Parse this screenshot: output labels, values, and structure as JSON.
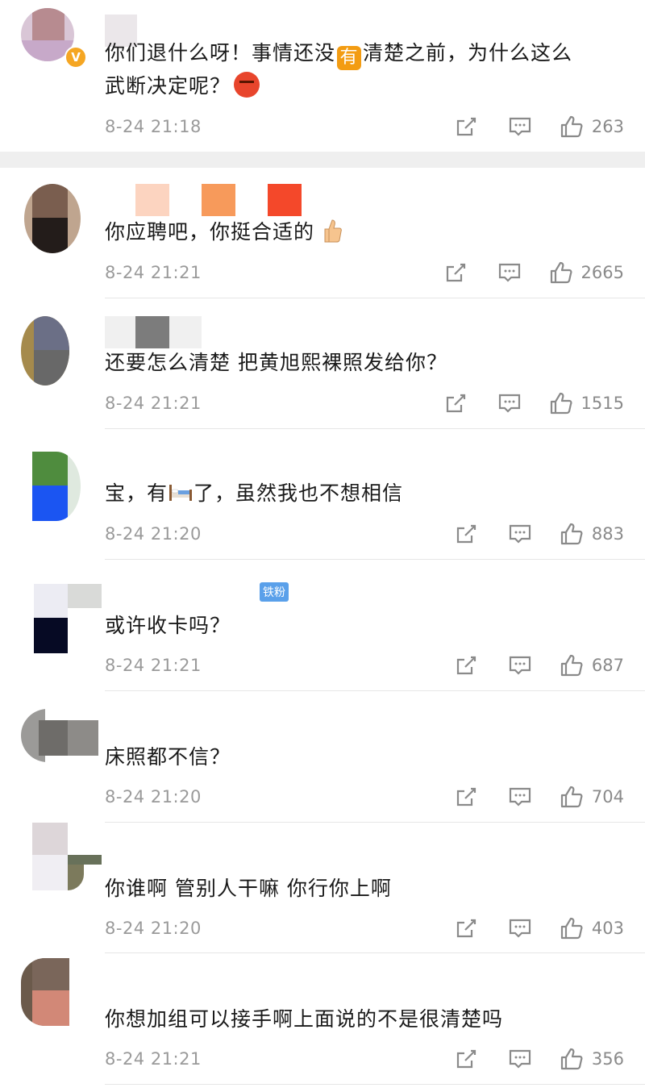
{
  "comments": [
    {
      "text": "你们退什么呀！事情还没",
      "text_emoji": "有",
      "text_after": "清楚之前，为什么这么",
      "text_line2": "武断决定呢？",
      "time": "8-24 21:18",
      "likes": "263"
    },
    {
      "text": "你应聘吧，你挺合适的",
      "time": "8-24 21:21",
      "likes": "2665"
    },
    {
      "text": "还要怎么清楚 把黄旭熙裸照发给你？",
      "time": "8-24 21:21",
      "likes": "1515"
    },
    {
      "text_before": "宝，有",
      "text_after": "了，虽然我也不想相信",
      "time": "8-24 21:20",
      "likes": "883"
    },
    {
      "text": "或许收卡吗？",
      "time": "8-24 21:21",
      "likes": "687",
      "badge": "铁粉"
    },
    {
      "text": "床照都不信？",
      "time": "8-24 21:20",
      "likes": "704"
    },
    {
      "text": "你谁啊 管别人干嘛 你行你上啊",
      "time": "8-24 21:20",
      "likes": "403"
    },
    {
      "text": "你想加组可以接手啊上面说的不是很清楚吗",
      "time": "8-24 21:21",
      "likes": "356"
    }
  ],
  "icons": {
    "share": "share-icon",
    "reply": "comment-icon",
    "like": "thumbs-up-icon",
    "verified": "verified-badge-icon"
  },
  "colors": {
    "text": "#1a1a1a",
    "meta": "#9a9a9a",
    "badge": "#5aa0ea",
    "verified": "#f5a623"
  }
}
